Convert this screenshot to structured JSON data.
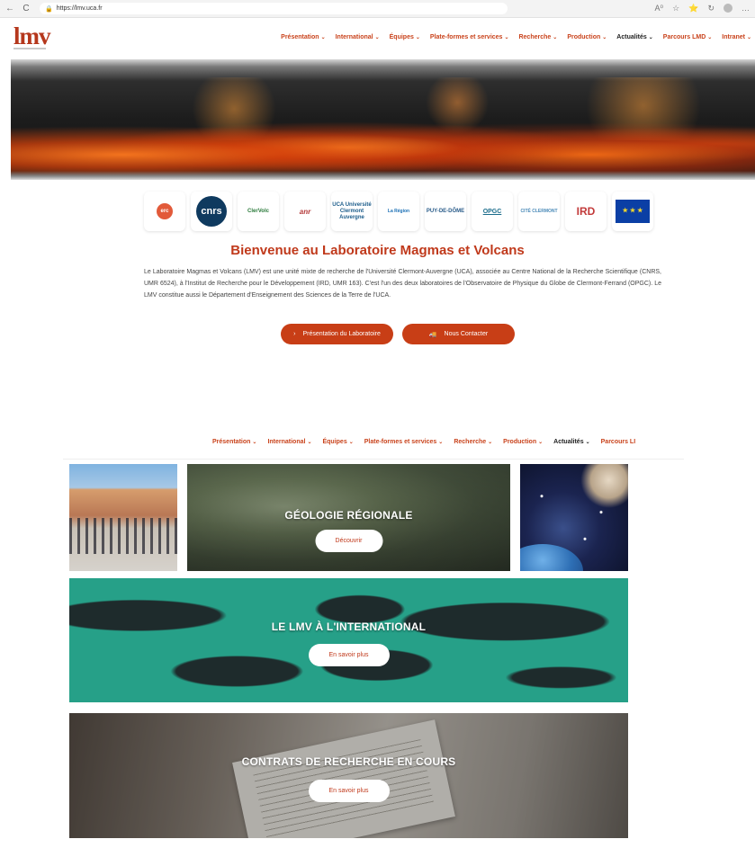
{
  "browser": {
    "url": "https://lmv.uca.fr",
    "back_icon": "←",
    "refresh_icon": "C",
    "lock_icon": "🔒",
    "toolbar_icons": [
      "A⁰",
      "☆",
      "⭐",
      "↻",
      "…"
    ]
  },
  "site": {
    "logo_text": "lmv",
    "brand_color": "#c0391b"
  },
  "nav": {
    "items": [
      {
        "label": "Présentation",
        "active": false
      },
      {
        "label": "International",
        "active": false
      },
      {
        "label": "Équipes",
        "active": false
      },
      {
        "label": "Plate-formes et services",
        "active": false
      },
      {
        "label": "Recherche",
        "active": false
      },
      {
        "label": "Production",
        "active": false
      },
      {
        "label": "Actualités",
        "active": true
      },
      {
        "label": "Parcours LMD",
        "active": false
      },
      {
        "label": "Intranet",
        "active": false
      }
    ],
    "chevron": "⌄"
  },
  "partners": [
    {
      "name": "erc",
      "label": "erc"
    },
    {
      "name": "cnrs",
      "label": "cnrs"
    },
    {
      "name": "clervolc",
      "label": "ClerVolc"
    },
    {
      "name": "anr",
      "label": "anr"
    },
    {
      "name": "uca",
      "label": "UCA Université Clermont Auvergne"
    },
    {
      "name": "region",
      "label": "La Région"
    },
    {
      "name": "puy-de-dome",
      "label": "PUY-DE-DÔME"
    },
    {
      "name": "opgc",
      "label": "OPGC"
    },
    {
      "name": "cite-clermont",
      "label": "CITÉ CLERMONT"
    },
    {
      "name": "ird",
      "label": "IRD"
    },
    {
      "name": "eu",
      "label": "★ ★ ★"
    }
  ],
  "welcome": {
    "title": "Bienvenue au Laboratoire Magmas et Volcans",
    "text": "Le Laboratoire Magmas et Volcans (LMV) est une unité mixte de recherche de l'Université Clermont-Auvergne (UCA), associée au Centre National de la Recherche Scientifique (CNRS, UMR 6524), à l'Institut de Recherche pour le Développement (IRD, UMR 163). C'est l'un des deux laboratoires de l'Observatoire de Physique du Globe de Clermont-Ferrand (OPGC). Le LMV constitue aussi le Département d'Enseignement des Sciences de la Terre de l'UCA."
  },
  "cta": {
    "presentation_label": "Présentation du Laboratoire",
    "presentation_icon": "›",
    "contact_label": "Nous Contacter",
    "contact_icon": "🚚"
  },
  "sticky_nav": {
    "items": [
      {
        "label": "Présentation",
        "active": false
      },
      {
        "label": "International",
        "active": false
      },
      {
        "label": "Équipes",
        "active": false
      },
      {
        "label": "Plate-formes et services",
        "active": false
      },
      {
        "label": "Recherche",
        "active": false
      },
      {
        "label": "Production",
        "active": false
      },
      {
        "label": "Actualités",
        "active": true
      },
      {
        "label": "Parcours LI",
        "active": false
      }
    ]
  },
  "tiles": {
    "geologie": {
      "title": "GÉOLOGIE RÉGIONALE",
      "button": "Découvrir"
    },
    "international": {
      "title": "LE LMV À L'INTERNATIONAL",
      "button": "En savoir plus"
    },
    "contrats": {
      "title": "CONTRATS DE RECHERCHE EN COURS",
      "button": "En savoir plus"
    }
  }
}
